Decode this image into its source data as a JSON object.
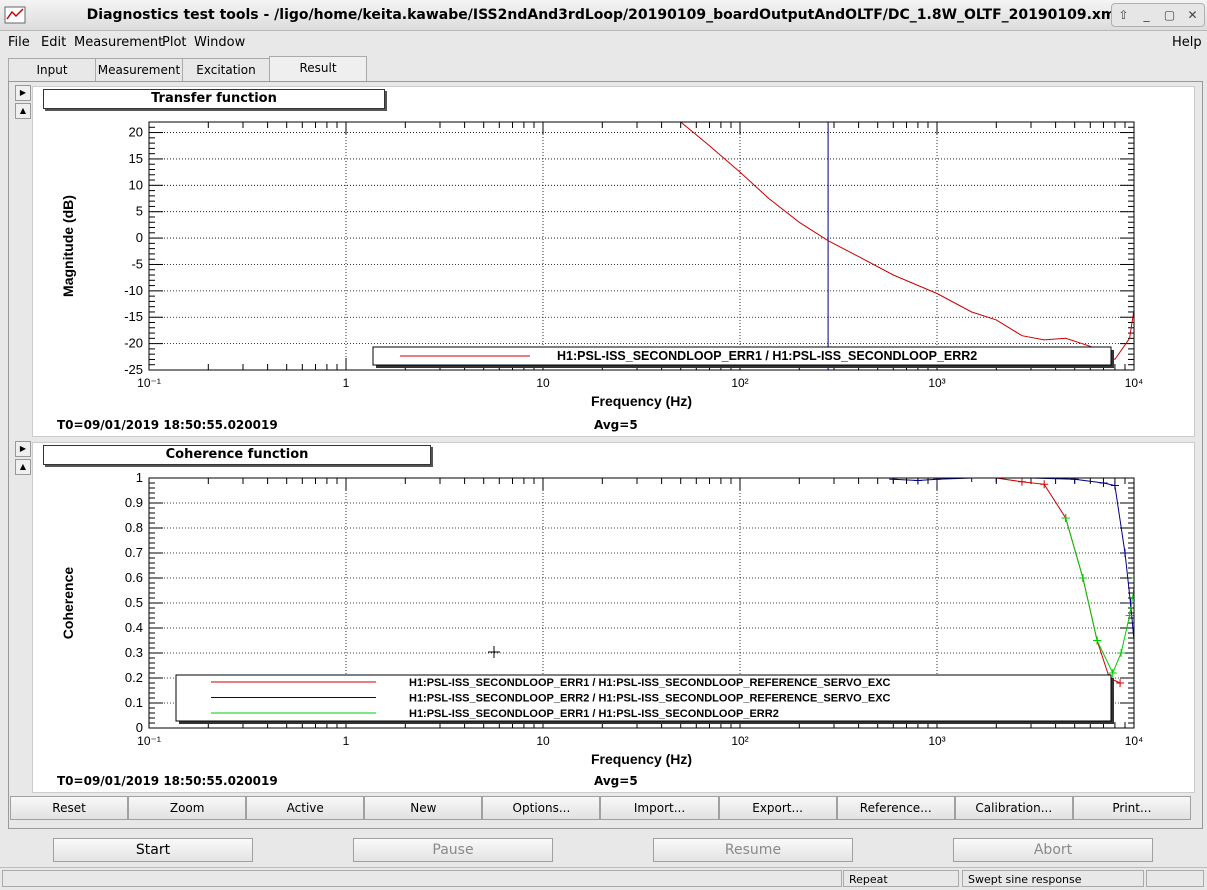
{
  "window": {
    "title": "Diagnostics test tools - /ligo/home/keita.kawabe/ISS2ndAnd3rdLoop/20190109_boardOutputAndOLTF/DC_1.8W_OLTF_20190109.xml",
    "controls": [
      "⇧",
      "_",
      "▢",
      "✕"
    ]
  },
  "menu": {
    "file": "File",
    "edit": "Edit",
    "measurement": "Measurement",
    "plot": "Plot",
    "window": "Window",
    "help": "Help"
  },
  "tabs": [
    "Input",
    "Measurement",
    "Excitation",
    "Result"
  ],
  "side_arrows": {
    "right": "▶",
    "up": "▲"
  },
  "plot1": {
    "title": "Transfer function",
    "info_t0": "T0=09/01/2019 18:50:55.020019",
    "info_avg": "Avg=5"
  },
  "plot2": {
    "title": "Coherence function",
    "info_t0": "T0=09/01/2019 18:50:55.020019",
    "info_avg": "Avg=5"
  },
  "chart_data": [
    {
      "type": "line",
      "title": "Transfer function",
      "xlabel": "Frequency (Hz)",
      "ylabel": "Magnitude (dB)",
      "xscale": "log",
      "xlim": [
        0.1,
        10000
      ],
      "ylim": [
        -25,
        22
      ],
      "yticks": [
        20,
        15,
        10,
        5,
        0,
        -5,
        -10,
        -15,
        -20,
        -25
      ],
      "xtick_labels": [
        "10⁻¹",
        "1",
        "10",
        "10²",
        "10³",
        "10⁴"
      ],
      "grid": true,
      "legend_placement": "bottom-right",
      "cursor_x": 280,
      "series": [
        {
          "name": "H1:PSL-ISS_SECONDLOOP_ERR1 / H1:PSL-ISS_SECONDLOOP_ERR2",
          "color": "#cc0000",
          "x": [
            50,
            70,
            100,
            140,
            200,
            280,
            400,
            600,
            1000,
            1500,
            2000,
            2700,
            3500,
            4500,
            6000,
            8000,
            9500,
            10300
          ],
          "y": [
            22,
            17.5,
            12.5,
            7.5,
            3,
            -0.5,
            -3.5,
            -7,
            -10.5,
            -14,
            -15.5,
            -18.5,
            -19.3,
            -19,
            -20.5,
            -23,
            -19,
            -10.5
          ]
        }
      ]
    },
    {
      "type": "line",
      "title": "Coherence function",
      "xlabel": "Frequency (Hz)",
      "ylabel": "Coherence",
      "xscale": "log",
      "xlim": [
        0.1,
        10000
      ],
      "ylim": [
        0,
        1
      ],
      "yticks": [
        1,
        0.9,
        0.8,
        0.7,
        0.6,
        0.5,
        0.4,
        0.3,
        0.2,
        0.1,
        0
      ],
      "xtick_labels": [
        "10⁻¹",
        "1",
        "10",
        "10²",
        "10³",
        "10⁴"
      ],
      "grid": true,
      "legend_placement": "bottom",
      "series": [
        {
          "name": "H1:PSL-ISS_SECONDLOOP_ERR1 / H1:PSL-ISS_SECONDLOOP_REFERENCE_SERVO_EXC",
          "color": "#cc0000",
          "x": [
            2000,
            2700,
            3500,
            4500,
            5500,
            6500,
            7500,
            8500
          ],
          "y": [
            1,
            0.985,
            0.975,
            0.84,
            0.6,
            0.35,
            0.2,
            0.18
          ]
        },
        {
          "name": "H1:PSL-ISS_SECONDLOOP_ERR2 / H1:PSL-ISS_SECONDLOOP_REFERENCE_SERVO_EXC",
          "color": "#000080",
          "x": [
            600,
            800,
            1000,
            1500,
            2000,
            3000,
            5000,
            7000,
            8000,
            9000,
            9600,
            10200
          ],
          "y": [
            0.995,
            0.99,
            0.995,
            1,
            1,
            1,
            0.995,
            0.98,
            0.97,
            0.7,
            0.5,
            0.28
          ]
        },
        {
          "name": "H1:PSL-ISS_SECONDLOOP_ERR1 / H1:PSL-ISS_SECONDLOOP_ERR2",
          "color": "#00cc00",
          "x": [
            4500,
            5500,
            6500,
            7800,
            8600,
            9500,
            10200
          ],
          "y": [
            0.84,
            0.6,
            0.35,
            0.22,
            0.3,
            0.45,
            0.6
          ]
        }
      ]
    }
  ],
  "toolbar": [
    "Reset",
    "Zoom",
    "Active",
    "New",
    "Options...",
    "Import...",
    "Export...",
    "Reference...",
    "Calibration...",
    "Print..."
  ],
  "actions": {
    "start": "Start",
    "pause": "Pause",
    "resume": "Resume",
    "abort": "Abort"
  },
  "status": {
    "mode": "Repeat",
    "type": "Swept sine response"
  }
}
